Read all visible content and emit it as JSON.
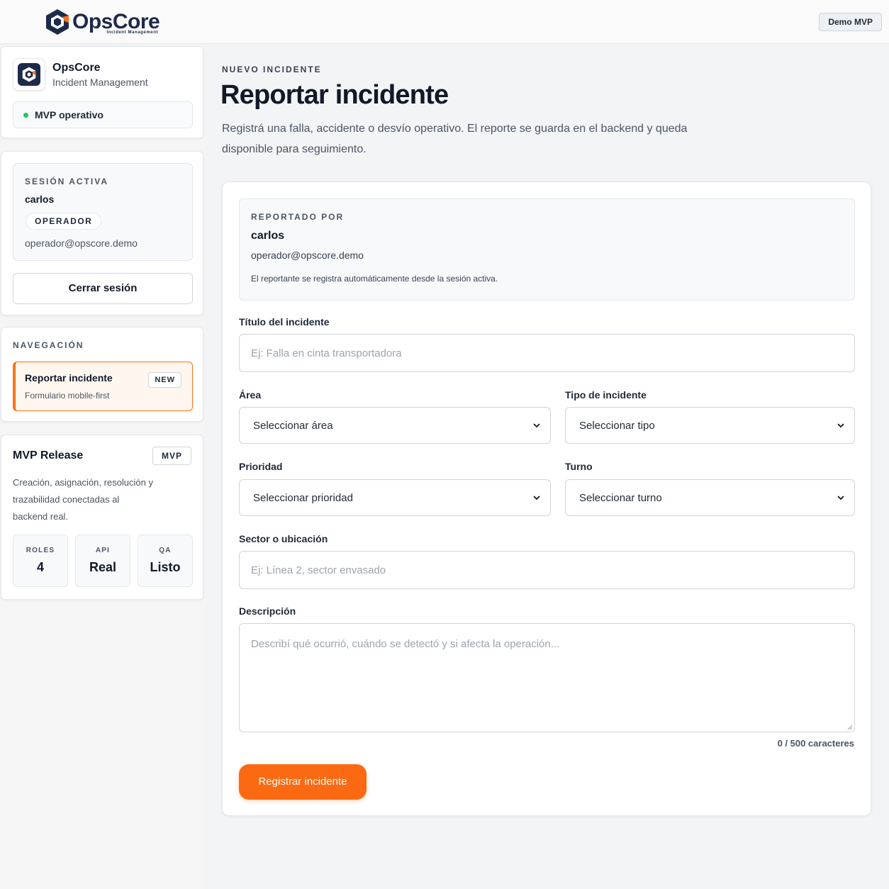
{
  "header": {
    "brand_name": "OpsCore",
    "brand_sub": "Incident Management",
    "demo_label": "Demo MVP"
  },
  "sidebar": {
    "app": {
      "name": "OpsCore",
      "subtitle": "Incident Management",
      "status": "MVP operativo"
    },
    "session": {
      "label": "SESIÓN ACTIVA",
      "user": "carlos",
      "role": "OPERADOR",
      "email": "operador@opscore.demo",
      "logout_label": "Cerrar sesión"
    },
    "navigation": {
      "label": "NAVEGACIÓN",
      "items": [
        {
          "title": "Reportar incidente",
          "subtitle": "Formulario mobile-first",
          "badge": "NEW"
        }
      ]
    },
    "release": {
      "title": "MVP Release",
      "badge": "MVP",
      "description": "Creación, asignación, resolución y trazabilidad conectadas al backend real.",
      "stats": [
        {
          "label": "ROLES",
          "value": "4"
        },
        {
          "label": "API",
          "value": "Real"
        },
        {
          "label": "QA",
          "value": "Listo"
        }
      ]
    }
  },
  "main": {
    "eyebrow": "NUEVO INCIDENTE",
    "title": "Reportar incidente",
    "description": "Registrá una falla, accidente o desvío operativo. El reporte se guarda en el backend y queda disponible para seguimiento.",
    "reporter": {
      "label": "REPORTADO POR",
      "name": "carlos",
      "email": "operador@opscore.demo",
      "note": "El reportante se registra automáticamente desde la sesión activa."
    },
    "form": {
      "title_label": "Título del incidente",
      "title_placeholder": "Ej: Falla en cinta transportadora",
      "area_label": "Área",
      "area_value": "Seleccionar área",
      "type_label": "Tipo de incidente",
      "type_value": "Seleccionar tipo",
      "priority_label": "Prioridad",
      "priority_value": "Seleccionar prioridad",
      "shift_label": "Turno",
      "shift_value": "Seleccionar turno",
      "sector_label": "Sector o ubicación",
      "sector_placeholder": "Ej: Línea 2, sector envasado",
      "description_label": "Descripción",
      "description_placeholder": "Describí qué ocurrió, cuándo se detectó y si afecta la operación...",
      "char_count": "0 / 500 caracteres",
      "submit_label": "Registrar incidente"
    }
  },
  "colors": {
    "accent": "#f97316",
    "brand_navy": "#1e2a4a",
    "status_green": "#22c55e"
  },
  "icons": [
    "opscore-logo-icon",
    "status-dot-icon",
    "chevron-down-icon",
    "resize-grip-icon"
  ]
}
